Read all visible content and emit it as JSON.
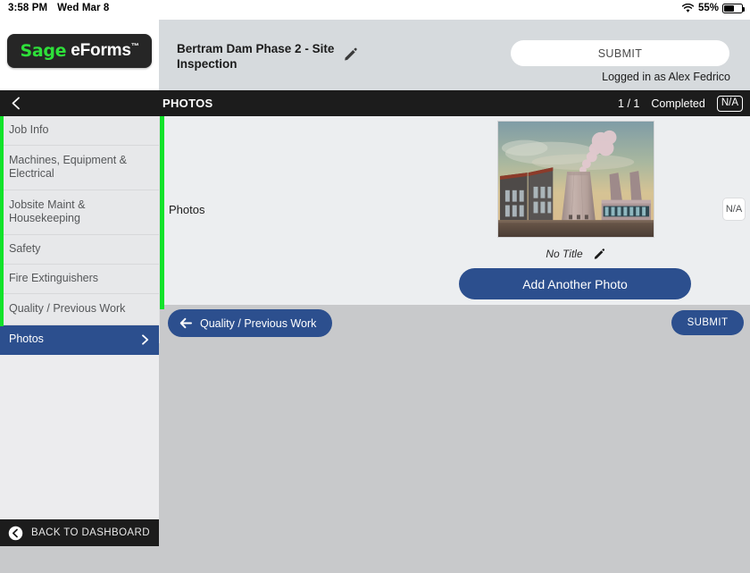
{
  "statusbar": {
    "time": "3:58 PM",
    "date": "Wed Mar 8",
    "battery_percent": "55%",
    "battery_level": 55,
    "wifi_icon": "wifi-icon",
    "battery_icon": "battery-icon"
  },
  "brand": {
    "logo_sage": "Sage",
    "logo_eforms": "eForms",
    "logo_tm": "™"
  },
  "header": {
    "form_title": "Bertram Dam Phase 2 - Site Inspection",
    "edit_title_icon": "pencil-icon",
    "submit_label": "SUBMIT",
    "logged_in_text": "Logged in as Alex Fedrico"
  },
  "section_bar": {
    "back_icon": "chevron-left-icon",
    "title": "PHOTOS",
    "progress": "1 / 1",
    "completed_label": "Completed",
    "na_label": "N/A"
  },
  "sidebar": {
    "items": [
      {
        "label": "Job Info",
        "selected": false
      },
      {
        "label": "Machines, Equipment & Electrical",
        "selected": false
      },
      {
        "label": "Jobsite Maint & Housekeeping",
        "selected": false
      },
      {
        "label": "Safety",
        "selected": false
      },
      {
        "label": "Fire Extinguishers",
        "selected": false
      },
      {
        "label": "Quality / Previous Work",
        "selected": false
      },
      {
        "label": "Photos",
        "selected": true
      }
    ],
    "back_to_dashboard": "BACK TO DASHBOARD",
    "back_to_dashboard_icon": "back-circle-icon",
    "accent_color": "#12e32a",
    "selected_color": "#2c4f8e"
  },
  "content": {
    "field_label": "Photos",
    "photo_caption": "No Title",
    "photo_edit_icon": "pencil-icon",
    "photo_alt": "industrial power plant with cooling tower",
    "add_photo_label": "Add Another Photo",
    "na_label": "N/A"
  },
  "bottom_bar": {
    "prev_icon": "arrow-left-icon",
    "prev_label": "Quality / Previous Work",
    "submit_label": "SUBMIT"
  },
  "colors": {
    "brand_green": "#2ee03a",
    "accent_blue": "#2c4f8e",
    "header_gray": "#d6dadd",
    "content_gray": "#c8c9cb",
    "bar_black": "#1c1c1c"
  }
}
